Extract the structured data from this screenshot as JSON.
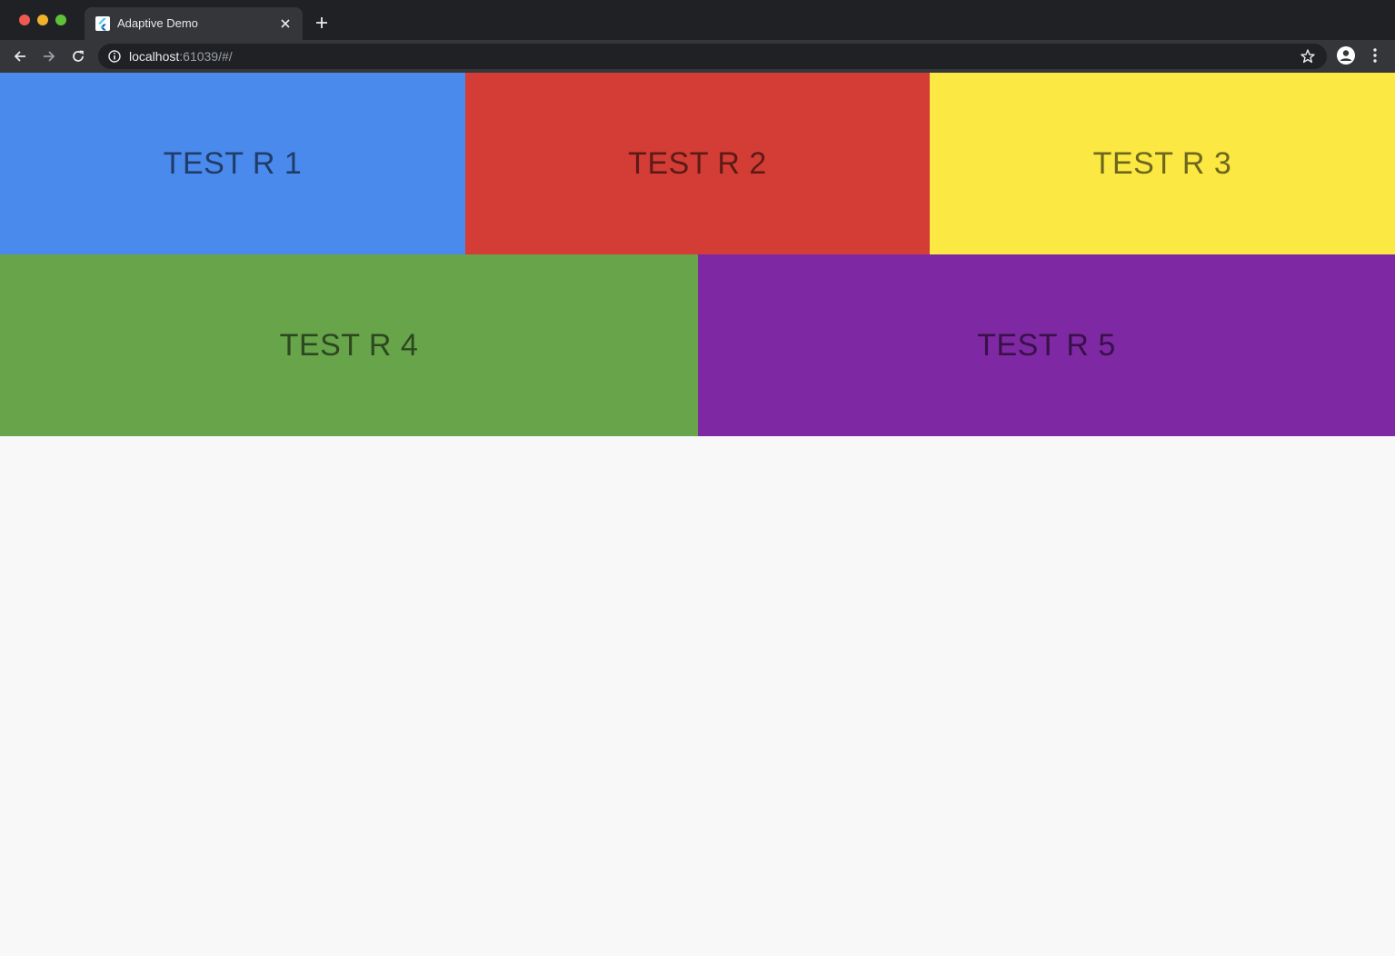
{
  "browser": {
    "tab_title": "Adaptive Demo",
    "url_host": "localhost",
    "url_rest": ":61039/#/",
    "icons": {
      "favicon": "flutter-icon",
      "tab_close": "close-icon",
      "new_tab": "plus-icon",
      "back": "arrow-left-icon",
      "forward": "arrow-right-icon",
      "reload": "reload-icon",
      "site_info": "info-icon",
      "bookmark": "star-icon",
      "profile": "person-icon",
      "menu": "kebab-menu-icon"
    }
  },
  "tiles": [
    {
      "label": "TEST R 1",
      "color": "#4a8aec"
    },
    {
      "label": "TEST R 2",
      "color": "#d33d35"
    },
    {
      "label": "TEST R 3",
      "color": "#fbe843"
    },
    {
      "label": "TEST R 4",
      "color": "#67a44a"
    },
    {
      "label": "TEST R 5",
      "color": "#7f28a4"
    }
  ]
}
